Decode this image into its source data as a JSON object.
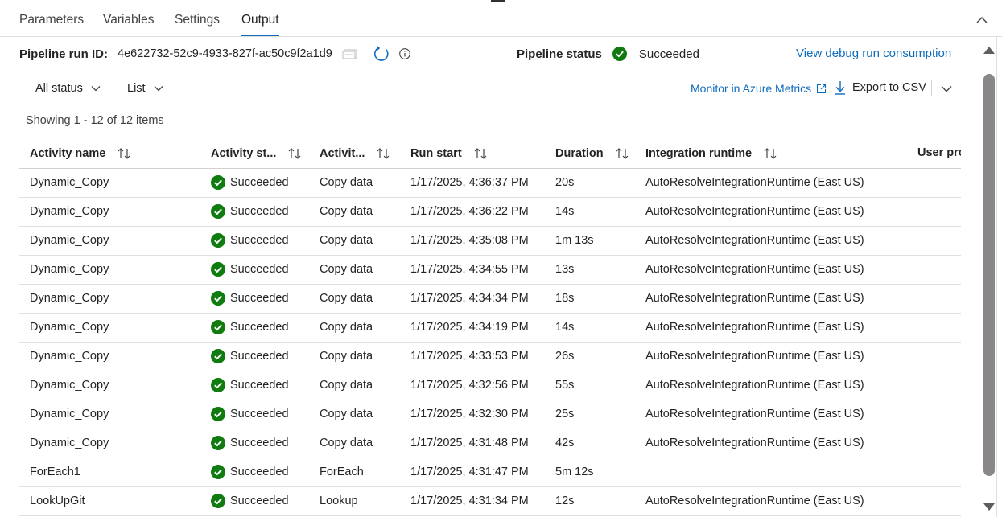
{
  "tabs": [
    {
      "label": "Parameters"
    },
    {
      "label": "Variables"
    },
    {
      "label": "Settings"
    },
    {
      "label": "Output",
      "active": true
    }
  ],
  "run": {
    "id_label": "Pipeline run ID:",
    "id_value": "4e622732-52c9-4933-827f-ac50c9f2a1d9",
    "status_label": "Pipeline status",
    "status_value": "Succeeded",
    "debug_link": "View debug run consumption"
  },
  "toolbar": {
    "status_filter": "All status",
    "view_filter": "List",
    "monitor_link": "Monitor in Azure Metrics",
    "export_label": "Export to CSV"
  },
  "showing": "Showing 1 - 12 of 12 items",
  "columns": [
    {
      "label": "Activity name"
    },
    {
      "label": "Activity st..."
    },
    {
      "label": "Activit..."
    },
    {
      "label": "Run start"
    },
    {
      "label": "Duration"
    },
    {
      "label": "Integration runtime"
    },
    {
      "label": "User pro"
    }
  ],
  "rows": [
    {
      "name": "Dynamic_Copy",
      "status": "Succeeded",
      "type": "Copy data",
      "start": "1/17/2025, 4:36:37 PM",
      "duration": "20s",
      "runtime": "AutoResolveIntegrationRuntime (East US)"
    },
    {
      "name": "Dynamic_Copy",
      "status": "Succeeded",
      "type": "Copy data",
      "start": "1/17/2025, 4:36:22 PM",
      "duration": "14s",
      "runtime": "AutoResolveIntegrationRuntime (East US)"
    },
    {
      "name": "Dynamic_Copy",
      "status": "Succeeded",
      "type": "Copy data",
      "start": "1/17/2025, 4:35:08 PM",
      "duration": "1m 13s",
      "runtime": "AutoResolveIntegrationRuntime (East US)"
    },
    {
      "name": "Dynamic_Copy",
      "status": "Succeeded",
      "type": "Copy data",
      "start": "1/17/2025, 4:34:55 PM",
      "duration": "13s",
      "runtime": "AutoResolveIntegrationRuntime (East US)"
    },
    {
      "name": "Dynamic_Copy",
      "status": "Succeeded",
      "type": "Copy data",
      "start": "1/17/2025, 4:34:34 PM",
      "duration": "18s",
      "runtime": "AutoResolveIntegrationRuntime (East US)"
    },
    {
      "name": "Dynamic_Copy",
      "status": "Succeeded",
      "type": "Copy data",
      "start": "1/17/2025, 4:34:19 PM",
      "duration": "14s",
      "runtime": "AutoResolveIntegrationRuntime (East US)"
    },
    {
      "name": "Dynamic_Copy",
      "status": "Succeeded",
      "type": "Copy data",
      "start": "1/17/2025, 4:33:53 PM",
      "duration": "26s",
      "runtime": "AutoResolveIntegrationRuntime (East US)"
    },
    {
      "name": "Dynamic_Copy",
      "status": "Succeeded",
      "type": "Copy data",
      "start": "1/17/2025, 4:32:56 PM",
      "duration": "55s",
      "runtime": "AutoResolveIntegrationRuntime (East US)"
    },
    {
      "name": "Dynamic_Copy",
      "status": "Succeeded",
      "type": "Copy data",
      "start": "1/17/2025, 4:32:30 PM",
      "duration": "25s",
      "runtime": "AutoResolveIntegrationRuntime (East US)"
    },
    {
      "name": "Dynamic_Copy",
      "status": "Succeeded",
      "type": "Copy data",
      "start": "1/17/2025, 4:31:48 PM",
      "duration": "42s",
      "runtime": "AutoResolveIntegrationRuntime (East US)"
    },
    {
      "name": "ForEach1",
      "status": "Succeeded",
      "type": "ForEach",
      "start": "1/17/2025, 4:31:47 PM",
      "duration": "5m 12s",
      "runtime": ""
    },
    {
      "name": "LookUpGit",
      "status": "Succeeded",
      "type": "Lookup",
      "start": "1/17/2025, 4:31:34 PM",
      "duration": "12s",
      "runtime": "AutoResolveIntegrationRuntime (East US)"
    }
  ],
  "colors": {
    "accent": "#0f6cbd",
    "success": "#107c10"
  }
}
